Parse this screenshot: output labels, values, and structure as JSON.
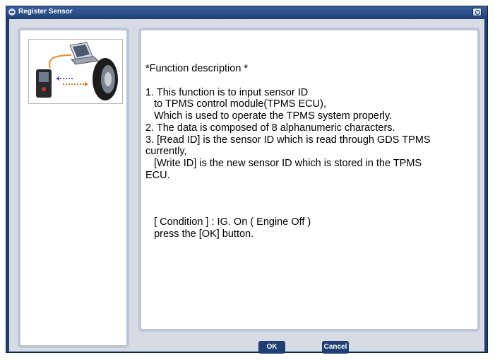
{
  "window": {
    "title": "Register Sensor"
  },
  "description": {
    "heading": "*Function description *",
    "lines": [
      "1. This function is to input sensor ID",
      "   to TPMS control module(TPMS ECU),",
      "   Which is used to operate the TPMS system properly.",
      "2. The data is composed of 8 alphanumeric characters.",
      "3. [Read ID] is the sensor ID which is read through GDS TPMS",
      "currently,",
      "   [Write ID] is the new sensor ID which is stored in the TPMS",
      "ECU."
    ],
    "condition": "   [ Condition ] : IG. On ( Engine Off )",
    "instruction": "   press the [OK] button."
  },
  "buttons": {
    "ok": "OK",
    "cancel": "Cancel"
  },
  "colors": {
    "titlebar": "#24457c",
    "button": "#1f3f72",
    "panel_border": "#bcc6d6"
  }
}
